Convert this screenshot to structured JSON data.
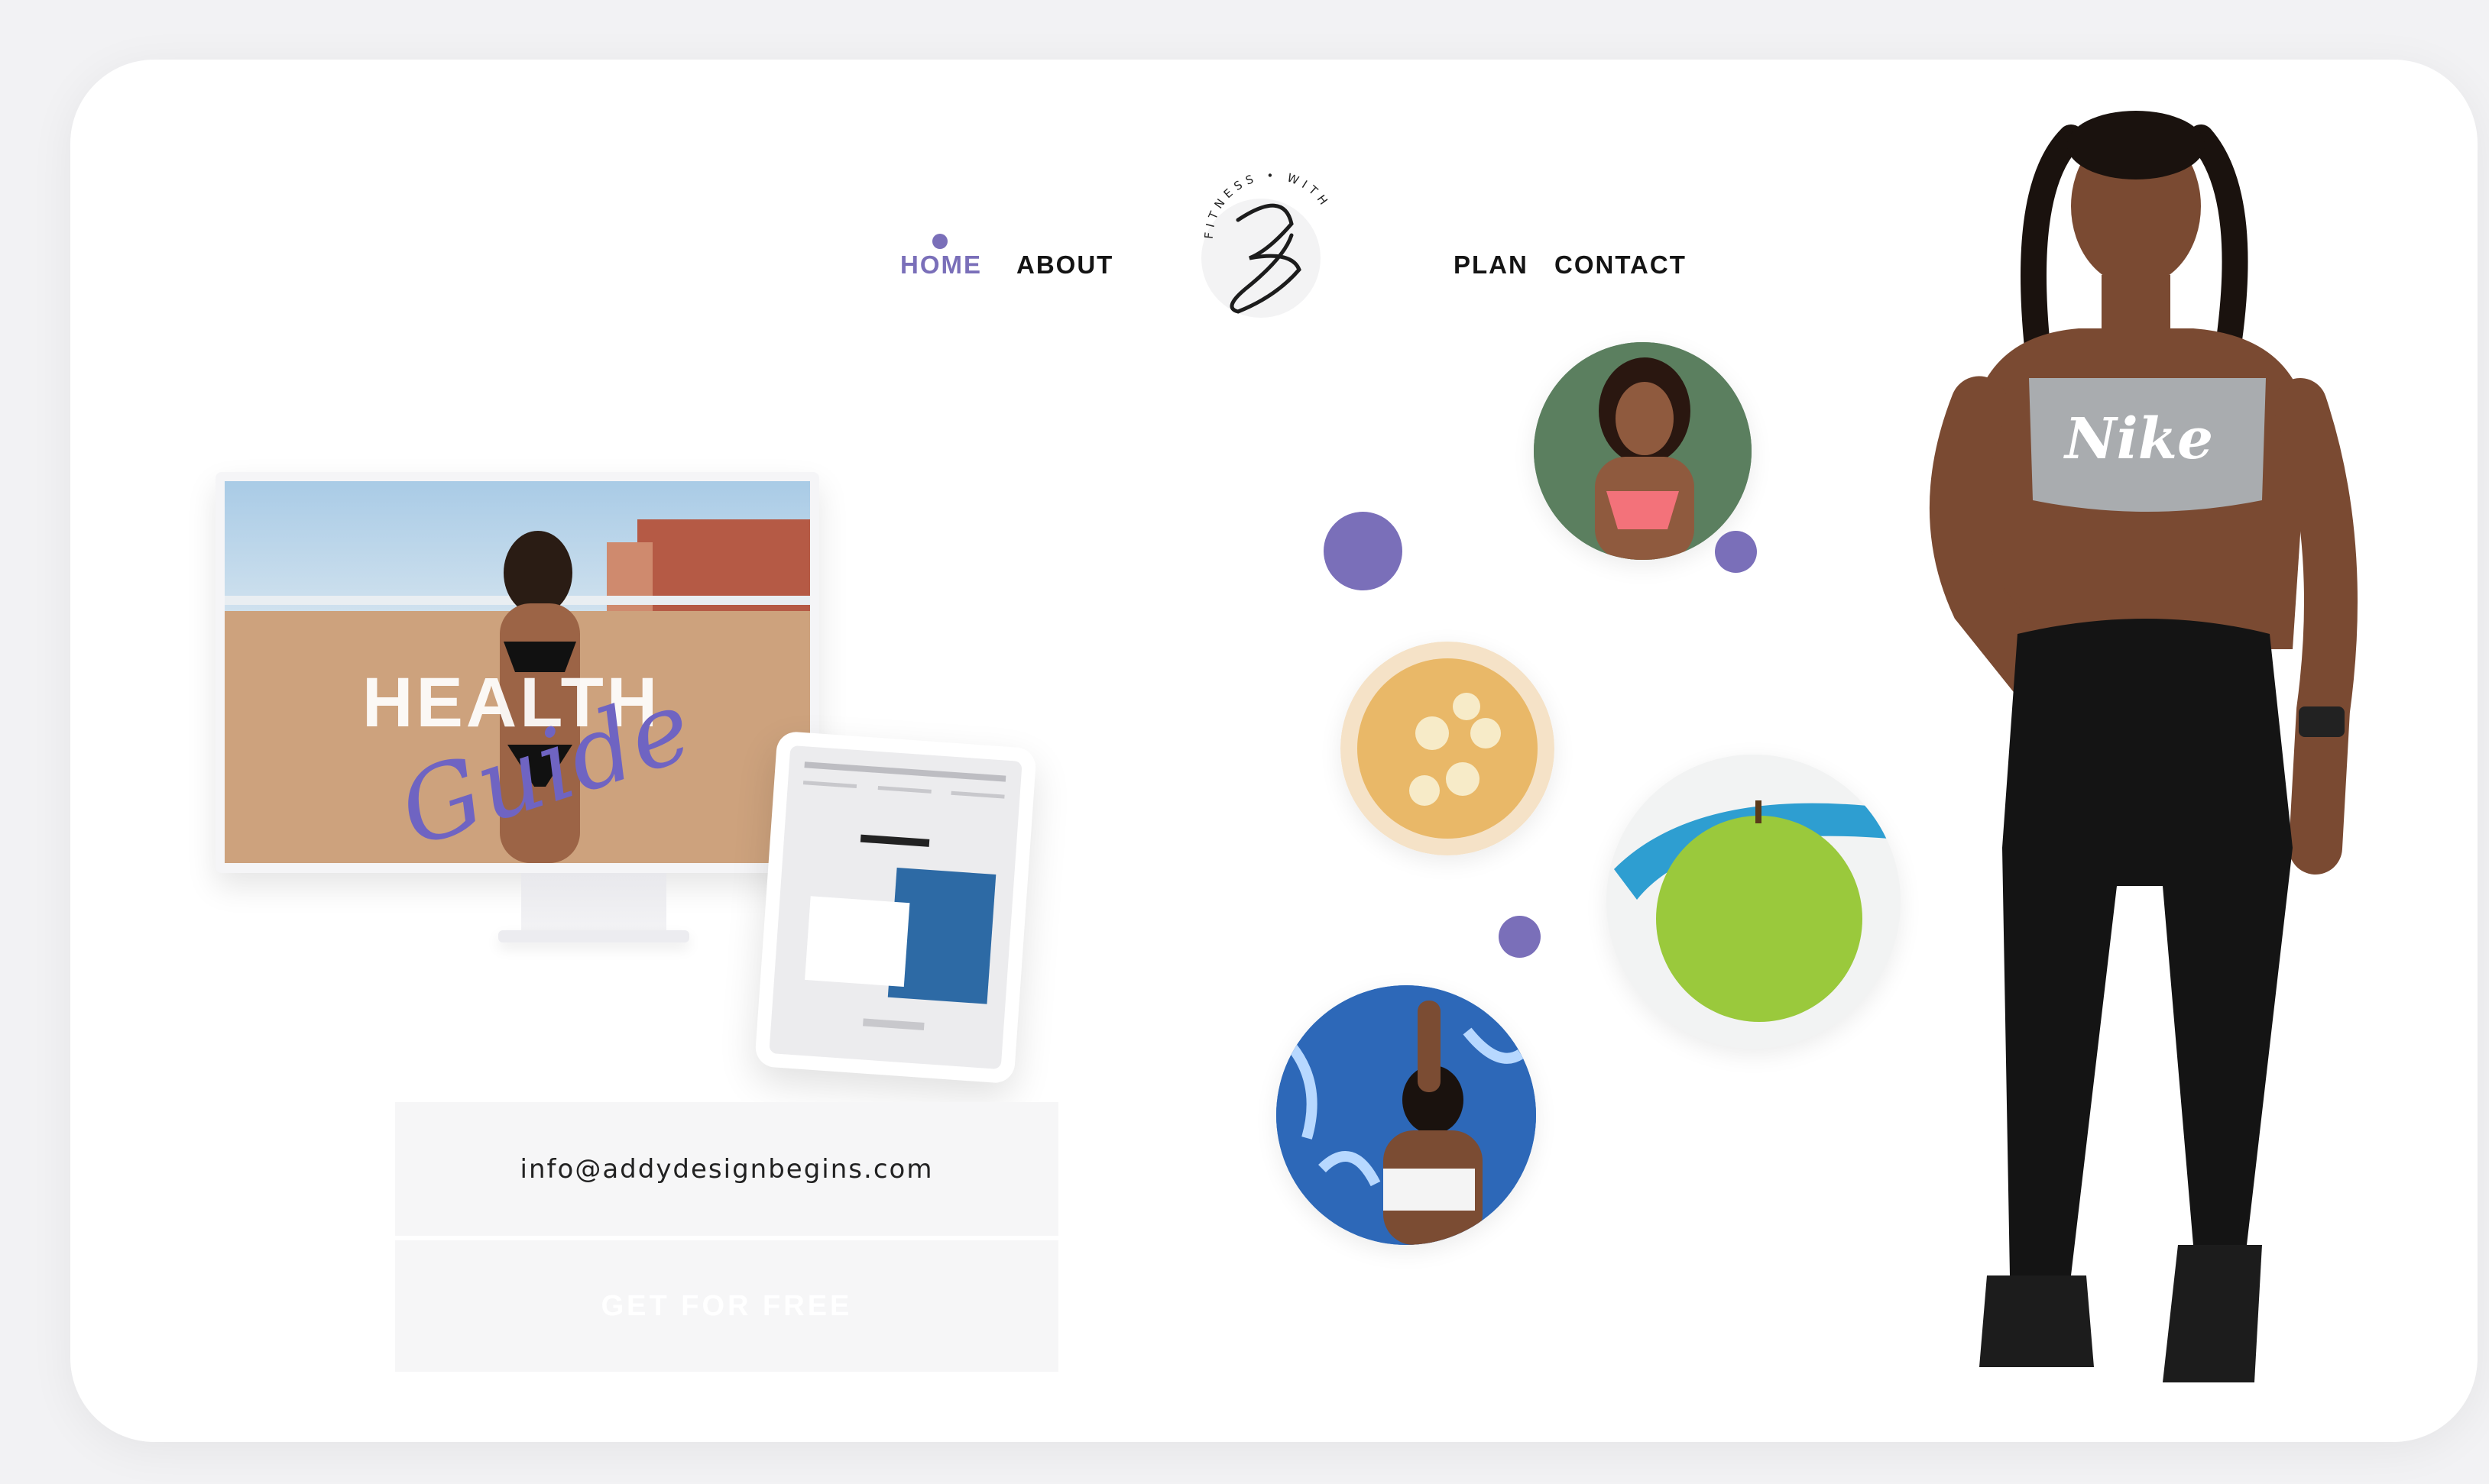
{
  "nav": {
    "left": [
      {
        "label": "HOME",
        "active": true
      },
      {
        "label": "ABOUT",
        "active": false
      }
    ],
    "right": [
      {
        "label": "PLAN",
        "active": false
      },
      {
        "label": "CONTACT",
        "active": false
      }
    ],
    "logo_ring_text": "FITNESS • WITH",
    "logo_initial": "Z"
  },
  "hero": {
    "headline": "HEALTH",
    "script": "Guide"
  },
  "form": {
    "email": "info@addydesignbegins.com",
    "cta": "GET FOR FREE"
  },
  "model": {
    "top_brand": "Nike"
  },
  "colors": {
    "accent": "#7a6fb9",
    "text": "#141414",
    "card": "#ffffff",
    "field": "#f6f6f7"
  },
  "icons": {
    "logo": "fitness-logo-icon"
  }
}
